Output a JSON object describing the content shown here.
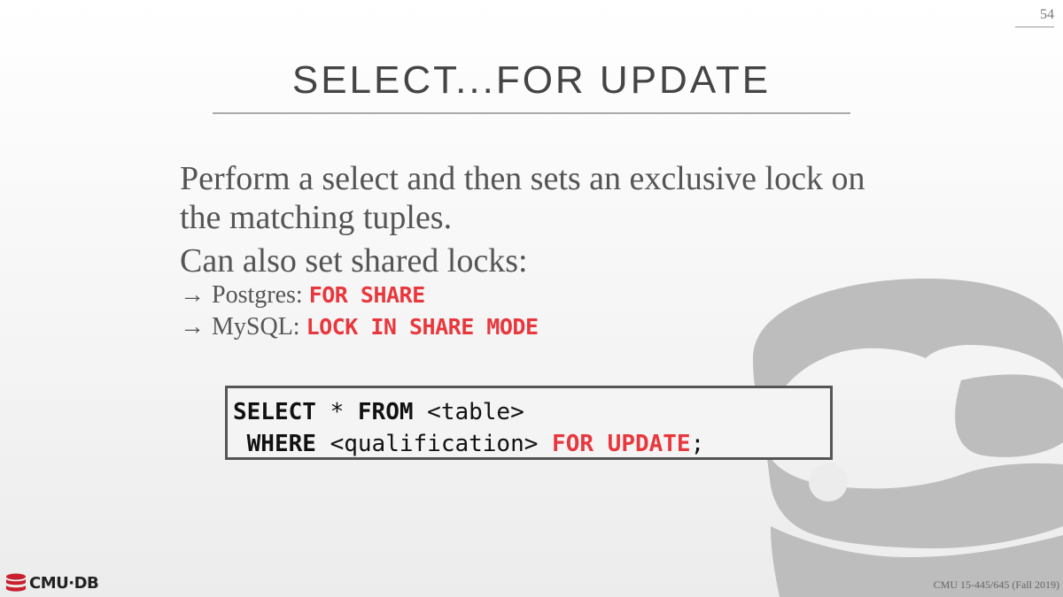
{
  "slide_number": "54",
  "title": "SELECT...FOR UPDATE",
  "body": {
    "paragraph1": "Perform a select and then sets an exclusive lock on the matching tuples.",
    "paragraph2": "Can also set shared locks:",
    "items": [
      {
        "arrow": "→",
        "label": "Postgres: ",
        "keyword": "FOR SHARE"
      },
      {
        "arrow": "→",
        "label": "MySQL: ",
        "keyword": "LOCK IN SHARE MODE"
      }
    ]
  },
  "code": {
    "line1": {
      "kw1": "SELECT",
      "t1": " * ",
      "kw2": "FROM",
      "t2": " <table>"
    },
    "line2": {
      "lead": " ",
      "kw1": "WHERE",
      "t1": " <qualification> ",
      "kw2": "FOR UPDATE",
      "t2": ";"
    }
  },
  "logo": {
    "icon": "database-icon",
    "text": "CMU·DB"
  },
  "footer": "CMU 15-445/645 (Fall 2019)",
  "colors": {
    "keyword": "#e8383d",
    "text": "#555555",
    "decoration": "#bdbdbd"
  }
}
